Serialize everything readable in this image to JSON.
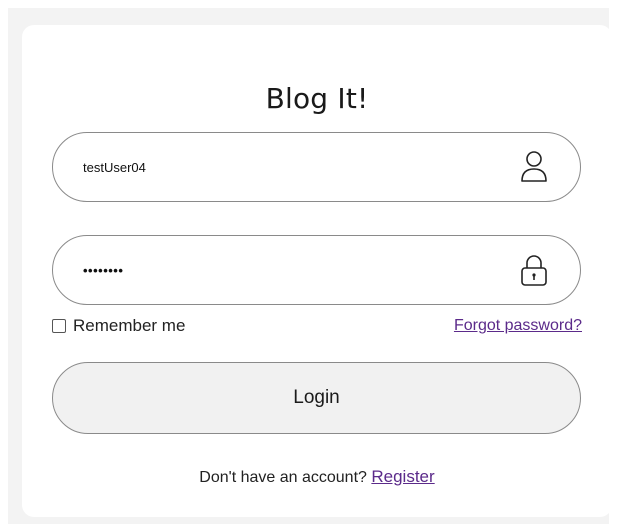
{
  "app": {
    "title": "Blog It!"
  },
  "form": {
    "username": {
      "value": "testUser04",
      "icon": "user-icon"
    },
    "password": {
      "value": "••••••••",
      "icon": "lock-icon"
    },
    "remember_label": "Remember me",
    "remember_checked": false,
    "forgot_label": "Forgot password?",
    "login_label": "Login",
    "signup_prompt": "Don't have an account?",
    "register_label": "Register"
  },
  "colors": {
    "link": "#5b2a8a",
    "border": "#8a8a8a",
    "page_background": "#f3f3f3",
    "card_background": "#ffffff",
    "button_background": "#f1f1f1"
  }
}
